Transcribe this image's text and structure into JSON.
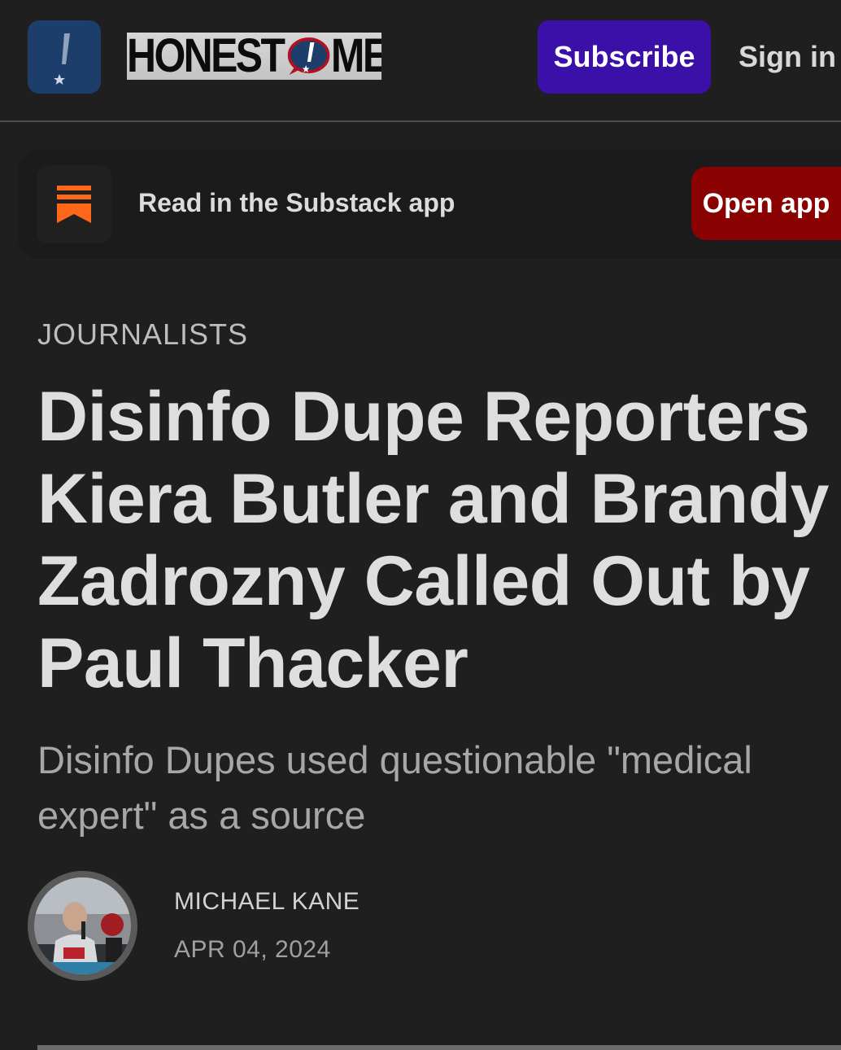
{
  "header": {
    "logo_text_left": "HONEST",
    "logo_text_right": "MEDIA",
    "subscribe_label": "Subscribe",
    "signin_label": "Sign in"
  },
  "banner": {
    "text": "Read in the Substack app",
    "open_label": "Open app"
  },
  "article": {
    "section": "JOURNALISTS",
    "title": "Disinfo Dupe Reporters Kiera Butler and Brandy Zadrozny Called Out by Paul Thacker",
    "subtitle": "Disinfo Dupes used questionable \"medical expert\" as a source",
    "author": "MICHAEL KANE",
    "date": "APR 04, 2024"
  },
  "icons": {
    "app_icon": "exclamation-star-icon",
    "substack_icon": "substack-bookmark-icon",
    "avatar": "author-avatar"
  },
  "colors": {
    "background": "#1f1f1f",
    "subscribe": "#3a10a8",
    "open_app": "#8a0202",
    "app_icon_bg": "#1d3e6b",
    "substack_orange": "#ff6719"
  }
}
